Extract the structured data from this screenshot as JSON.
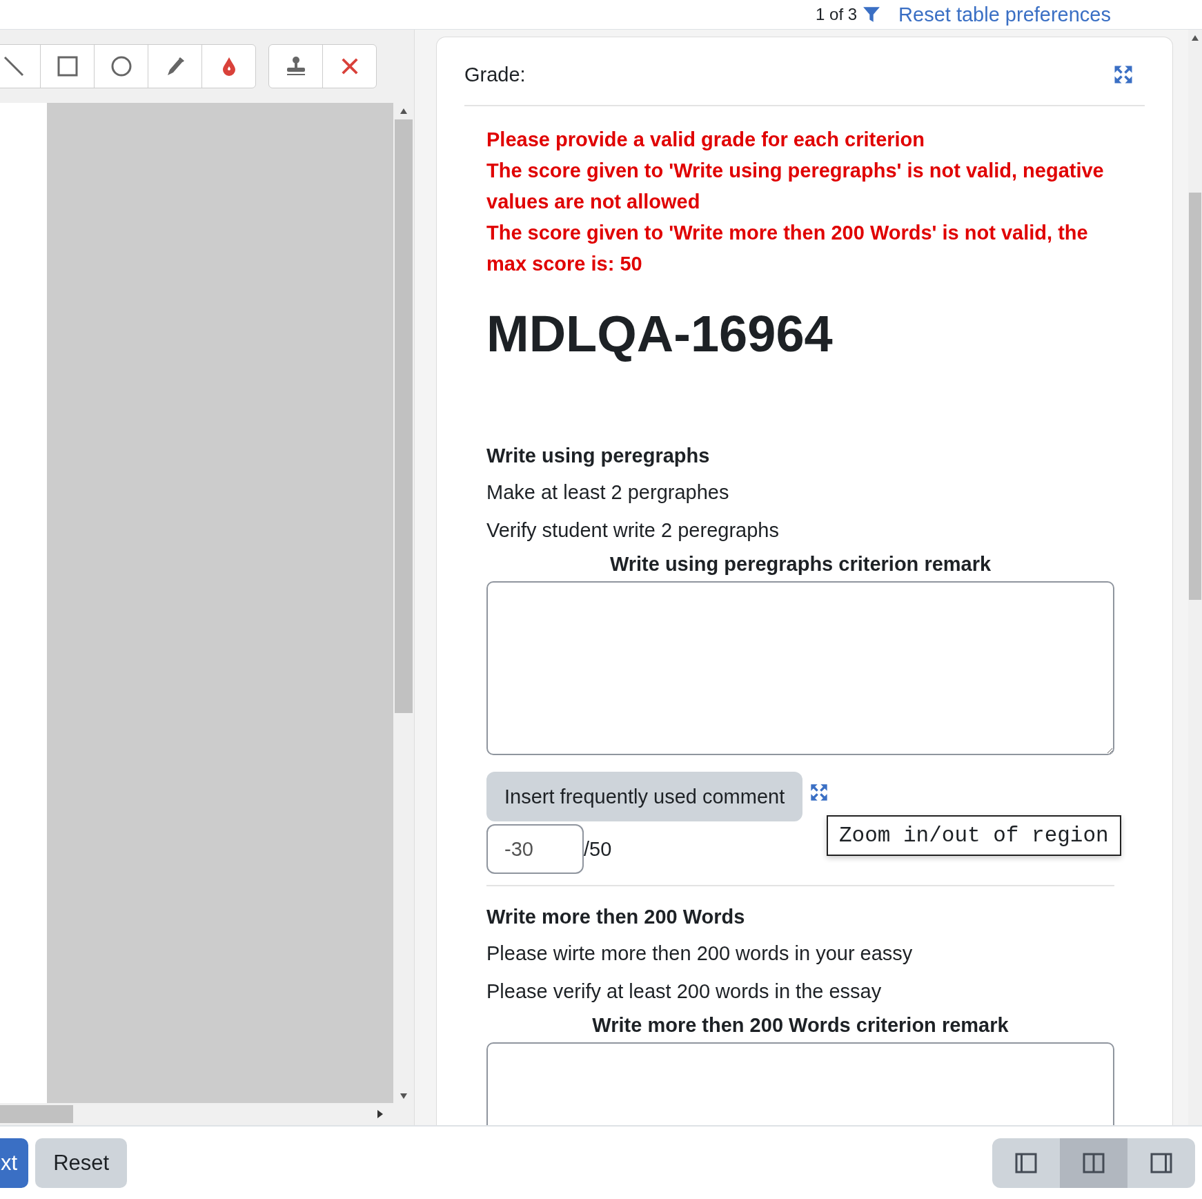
{
  "top_bar": {
    "pager": "1 of 3",
    "reset_link": "Reset table preferences"
  },
  "annotation_toolbar": {
    "groups": [
      {
        "tools": [
          {
            "kind": "line"
          },
          {
            "kind": "rectangle"
          },
          {
            "kind": "oval"
          },
          {
            "kind": "pen"
          },
          {
            "kind": "color"
          }
        ]
      },
      {
        "tools": [
          {
            "kind": "stamp"
          },
          {
            "kind": "delete"
          }
        ]
      }
    ]
  },
  "grade_panel": {
    "title": "Grade:",
    "errors": [
      "Please provide a valid grade for each criterion",
      "The score given to 'Write using peregraphs' is not valid, negative values are not allowed",
      "The score given to 'Write more then 200 Words' is not valid, the max score is: 50"
    ],
    "heading": "MDLQA-16964",
    "criteria": [
      {
        "title": "Write using peregraphs",
        "description": "Make at least 2 pergraphes",
        "grader_note": "Verify student write 2 peregraphs",
        "remark_label": "Write using peregraphs criterion remark",
        "comment_button": "Insert frequently used comment",
        "score": "-30",
        "max_score": "/50"
      },
      {
        "title": "Write more then 200 Words",
        "description": "Please wirte more then 200 words in your eassy",
        "grader_note": "Please verify at least 200 words in the essay",
        "remark_label": "Write more then 200 Words criterion remark"
      }
    ],
    "tooltip": "Zoom in/out of region"
  },
  "bottom_bar": {
    "buttons": [
      {
        "label": "xt",
        "kind": "primary"
      },
      {
        "label": "Reset",
        "kind": "secondary"
      }
    ],
    "layout_toggles": [
      {
        "kind": "left",
        "selected": false
      },
      {
        "kind": "both",
        "selected": true
      },
      {
        "kind": "right",
        "selected": false
      }
    ]
  }
}
